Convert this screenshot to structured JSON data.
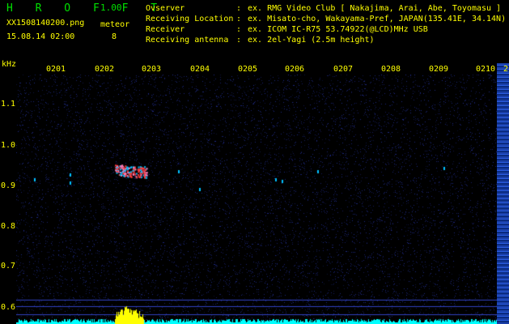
{
  "app": {
    "logo": "H R O F F T",
    "version": "1.00",
    "filename": "XX1508140200.png",
    "meteor_label": "meteor",
    "datetime": "15.08.14 02:00",
    "meteor_count": "8"
  },
  "info": [
    {
      "label": "Ovserver",
      "sep": ":",
      "value": "ex. RMG Video Club [ Nakajima, Arai, Abe, Toyomasu ]"
    },
    {
      "label": "Receiving Location",
      "sep": ":",
      "value": "ex. Misato-cho, Wakayama-Pref, JAPAN(135.41E, 34.14N)"
    },
    {
      "label": "Receiver",
      "sep": ":",
      "value": "ex. ICOM IC-R75 53.74922(@LCD)MHz USB"
    },
    {
      "label": "Receiving antenna",
      "sep": ":",
      "value": "ex. 2el-Yagi (2.5m height)"
    }
  ],
  "axis": {
    "unit": "kHz",
    "hours": [
      "0201",
      "0202",
      "0203",
      "0204",
      "0205",
      "0206",
      "0207",
      "0208",
      "0209",
      "0210",
      "2"
    ],
    "freqs": [
      "1.1",
      "1.0",
      "0.9",
      "0.8",
      "0.7",
      "0.6"
    ]
  },
  "colors": {
    "background": "#000000",
    "noise": "#1c2a9a",
    "echo_core": "#ff3a3a",
    "echo_mid": "#00c0ff",
    "activity_bar": "#ffff00",
    "baseline": "#00ffff",
    "text": "#ffff00",
    "logo": "#00e000"
  }
}
